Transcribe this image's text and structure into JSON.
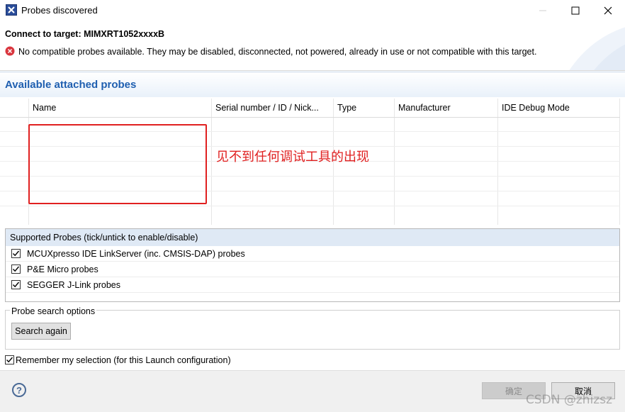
{
  "window": {
    "title": "Probes discovered",
    "app_icon": "x-app-icon"
  },
  "header": {
    "title": "Connect to target: MIMXRT1052xxxxB",
    "message": "No compatible probes available. They may be disabled, disconnected, not powered, already in use or not compatible with this target.",
    "message_icon": "error-icon"
  },
  "available": {
    "section_title": "Available attached probes",
    "columns": [
      "Name",
      "Serial number / ID / Nick...",
      "Type",
      "Manufacturer",
      "IDE Debug Mode"
    ],
    "rows": []
  },
  "annotation": {
    "text": "见不到任何调试工具的出现",
    "color": "#e02020"
  },
  "supported": {
    "title": "Supported Probes (tick/untick to enable/disable)",
    "items": [
      {
        "label": "MCUXpresso IDE LinkServer (inc. CMSIS-DAP) probes",
        "checked": true
      },
      {
        "label": "P&E Micro probes",
        "checked": true
      },
      {
        "label": "SEGGER J-Link probes",
        "checked": true
      }
    ]
  },
  "search": {
    "legend": "Probe search options",
    "button": "Search again"
  },
  "remember": {
    "label": "Remember my selection (for this Launch configuration)",
    "checked": true
  },
  "footer": {
    "ok": "确定",
    "cancel": "取消",
    "watermark": "CSDN @zhizsz"
  },
  "colors": {
    "section_title": "#1f5fb0",
    "error": "#d9363e"
  }
}
